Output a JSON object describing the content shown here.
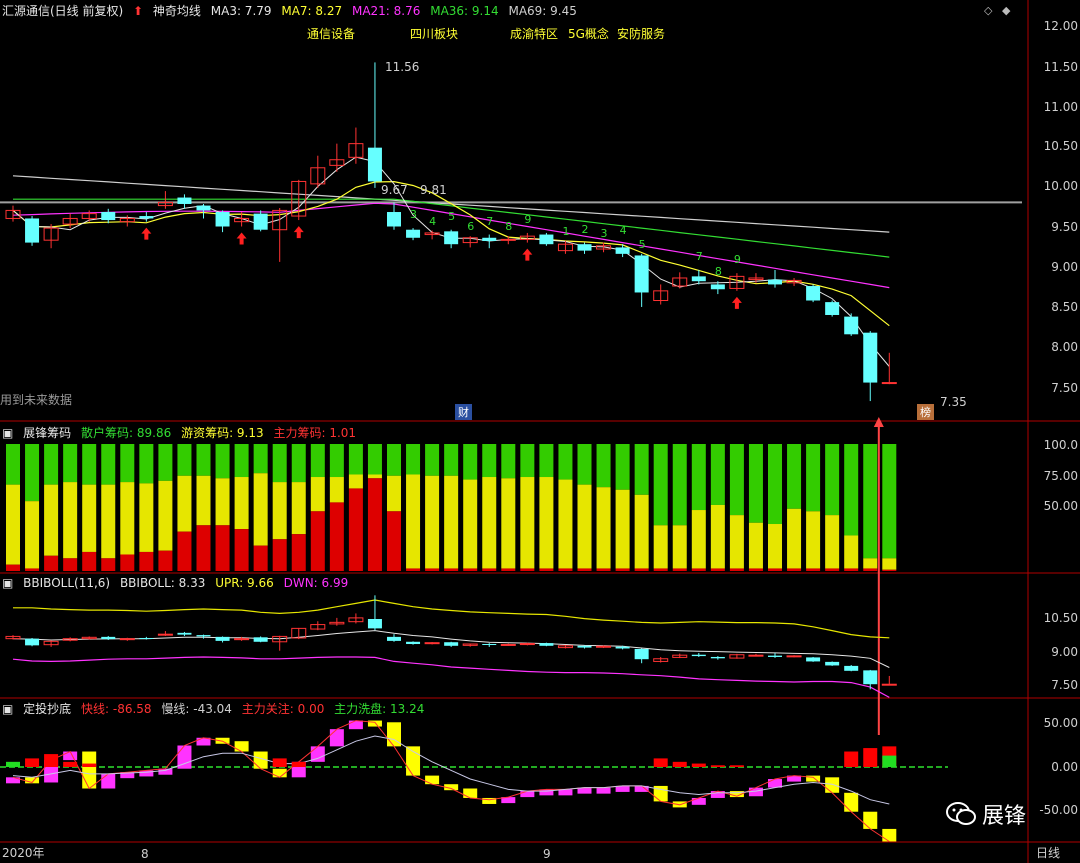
{
  "main_header": {
    "stock_title": "汇源通信(日线 前复权)",
    "indicator_name": "神奇均线",
    "ma3": "MA3: 7.79",
    "ma7": "MA7: 8.27",
    "ma21": "MA21: 8.76",
    "ma36": "MA36: 9.14",
    "ma69": "MA69: 9.45"
  },
  "concept_tags": [
    "通信设备",
    "四川板块",
    "成渝特区",
    "5G概念",
    "安防服务"
  ],
  "price_axis_labels": [
    "12.00",
    "11.50",
    "11.00",
    "10.50",
    "10.00",
    "9.50",
    "9.00",
    "8.50",
    "8.00",
    "7.50"
  ],
  "annotations": {
    "high_label": "11.56",
    "low_label": "7.35",
    "ref_label_1": "9.67",
    "ref_label_2": "9.81",
    "future_data_note": "用到未来数据",
    "finance_marker": "财",
    "rank_marker": "榜",
    "count_marks": [
      "3",
      "4",
      "5",
      "6",
      "7",
      "8",
      "9",
      "1",
      "2",
      "3",
      "4",
      "5",
      "7",
      "8",
      "9"
    ]
  },
  "panel2": {
    "name": "展锋筹码",
    "retail_label": "散户筹码: 89.86",
    "hot_money_label": "游资筹码: 9.13",
    "main_force_label": "主力筹码: 1.01",
    "axis": [
      "100.0",
      "75.00",
      "50.00"
    ]
  },
  "panel3": {
    "name": "BBIBOLL(11,6)",
    "bbiboll_label": "BBIBOLL: 8.33",
    "upr_label": "UPR: 9.66",
    "dwn_label": "DWN: 6.99",
    "axis": [
      "10.50",
      "9.00",
      "7.50"
    ]
  },
  "panel4": {
    "name": "定投抄底",
    "fast_label": "快线: -86.58",
    "slow_label": "慢线: -43.04",
    "focus_label": "主力关注: 0.00",
    "wash_label": "主力洗盘: 13.24",
    "axis": [
      "50.00",
      "0.00",
      "-50.00"
    ]
  },
  "bottom_bar": {
    "year": "2020年",
    "month_8": "8",
    "month_9": "9",
    "period": "日线"
  },
  "watermark": {
    "text": "展锋"
  },
  "colors": {
    "background": "#000000",
    "up_candle": "#ff3333",
    "down_candle": "#66ffff",
    "ma3": "#e6e6e6",
    "ma7": "#ffff33",
    "ma21": "#ff33ff",
    "ma36": "#33dd33",
    "ma69": "#cfcfcf",
    "retail": "#33cc00",
    "hot_money": "#e6e600",
    "main_force": "#dd0000"
  },
  "chart_data": {
    "type": "candlestick",
    "period": "daily",
    "candles": [
      {
        "o": 9.62,
        "c": 9.72,
        "h": 9.78,
        "l": 9.58
      },
      {
        "o": 9.62,
        "c": 9.32,
        "h": 9.65,
        "l": 9.28
      },
      {
        "o": 9.35,
        "c": 9.5,
        "h": 9.55,
        "l": 9.25
      },
      {
        "o": 9.55,
        "c": 9.62,
        "h": 9.68,
        "l": 9.5
      },
      {
        "o": 9.62,
        "c": 9.68,
        "h": 9.72,
        "l": 9.58
      },
      {
        "o": 9.7,
        "c": 9.6,
        "h": 9.74,
        "l": 9.56
      },
      {
        "o": 9.58,
        "c": 9.62,
        "h": 9.66,
        "l": 9.52
      },
      {
        "o": 9.65,
        "c": 9.62,
        "h": 9.7,
        "l": 9.58
      },
      {
        "o": 9.78,
        "c": 9.82,
        "h": 9.96,
        "l": 9.74
      },
      {
        "o": 9.88,
        "c": 9.8,
        "h": 9.92,
        "l": 9.74
      },
      {
        "o": 9.78,
        "c": 9.72,
        "h": 9.8,
        "l": 9.62
      },
      {
        "o": 9.7,
        "c": 9.52,
        "h": 9.72,
        "l": 9.45
      },
      {
        "o": 9.58,
        "c": 9.62,
        "h": 9.7,
        "l": 9.52
      },
      {
        "o": 9.68,
        "c": 9.48,
        "h": 9.72,
        "l": 9.46
      },
      {
        "o": 9.48,
        "c": 9.72,
        "h": 9.75,
        "l": 9.08
      },
      {
        "o": 9.65,
        "c": 10.08,
        "h": 10.1,
        "l": 9.6
      },
      {
        "o": 10.05,
        "c": 10.25,
        "h": 10.4,
        "l": 10.0
      },
      {
        "o": 10.28,
        "c": 10.35,
        "h": 10.55,
        "l": 10.2
      },
      {
        "o": 10.38,
        "c": 10.55,
        "h": 10.75,
        "l": 10.3
      },
      {
        "o": 10.5,
        "c": 10.08,
        "h": 11.56,
        "l": 10.0
      },
      {
        "o": 9.7,
        "c": 9.52,
        "h": 9.82,
        "l": 9.48
      },
      {
        "o": 9.48,
        "c": 9.38,
        "h": 9.5,
        "l": 9.35
      },
      {
        "o": 9.42,
        "c": 9.44,
        "h": 9.47,
        "l": 9.36
      },
      {
        "o": 9.46,
        "c": 9.3,
        "h": 9.48,
        "l": 9.25
      },
      {
        "o": 9.32,
        "c": 9.38,
        "h": 9.4,
        "l": 9.26
      },
      {
        "o": 9.38,
        "c": 9.34,
        "h": 9.42,
        "l": 9.25
      },
      {
        "o": 9.35,
        "c": 9.36,
        "h": 9.4,
        "l": 9.3
      },
      {
        "o": 9.36,
        "c": 9.4,
        "h": 9.44,
        "l": 9.32
      },
      {
        "o": 9.42,
        "c": 9.3,
        "h": 9.44,
        "l": 9.28
      },
      {
        "o": 9.22,
        "c": 9.3,
        "h": 9.34,
        "l": 9.18
      },
      {
        "o": 9.3,
        "c": 9.22,
        "h": 9.32,
        "l": 9.18
      },
      {
        "o": 9.24,
        "c": 9.28,
        "h": 9.32,
        "l": 9.2
      },
      {
        "o": 9.26,
        "c": 9.18,
        "h": 9.3,
        "l": 9.14
      },
      {
        "o": 9.16,
        "c": 8.7,
        "h": 9.18,
        "l": 8.52
      },
      {
        "o": 8.6,
        "c": 8.72,
        "h": 8.8,
        "l": 8.55
      },
      {
        "o": 8.78,
        "c": 8.88,
        "h": 8.95,
        "l": 8.75
      },
      {
        "o": 8.9,
        "c": 8.84,
        "h": 8.98,
        "l": 8.8
      },
      {
        "o": 8.8,
        "c": 8.74,
        "h": 8.84,
        "l": 8.68
      },
      {
        "o": 8.75,
        "c": 8.9,
        "h": 8.94,
        "l": 8.72
      },
      {
        "o": 8.86,
        "c": 8.88,
        "h": 8.94,
        "l": 8.82
      },
      {
        "o": 8.86,
        "c": 8.8,
        "h": 8.98,
        "l": 8.76
      },
      {
        "o": 8.82,
        "c": 8.85,
        "h": 8.88,
        "l": 8.78
      },
      {
        "o": 8.78,
        "c": 8.6,
        "h": 8.8,
        "l": 8.58
      },
      {
        "o": 8.58,
        "c": 8.42,
        "h": 8.6,
        "l": 8.4
      },
      {
        "o": 8.4,
        "c": 8.18,
        "h": 8.44,
        "l": 8.16
      },
      {
        "o": 8.2,
        "c": 7.58,
        "h": 8.22,
        "l": 7.35
      },
      {
        "o": 7.58,
        "c": 7.58,
        "h": 7.95,
        "l": 7.56
      }
    ],
    "chip_distribution": {
      "series_order": [
        "main_force",
        "hot_money",
        "retail"
      ],
      "main_force": [
        5,
        2,
        12,
        10,
        15,
        10,
        13,
        15,
        16,
        31,
        36,
        36,
        33,
        20,
        25,
        29,
        47,
        54,
        65,
        73,
        47,
        2,
        2,
        2,
        2,
        2,
        2,
        2,
        2,
        2,
        2,
        2,
        2,
        2,
        2,
        2,
        2,
        2,
        2,
        2,
        2,
        2,
        2,
        2,
        2,
        2,
        1
      ],
      "hot_money": [
        63,
        53,
        56,
        60,
        53,
        58,
        57,
        54,
        55,
        44,
        39,
        37,
        41,
        57,
        45,
        41,
        27,
        20,
        11,
        3,
        28,
        74,
        73,
        73,
        70,
        72,
        71,
        72,
        72,
        70,
        66,
        64,
        62,
        58,
        34,
        34,
        46,
        50,
        42,
        36,
        35,
        47,
        45,
        42,
        26,
        8,
        9
      ]
    },
    "bbiboll": {
      "bbiboll": [
        9.62,
        9.6,
        9.56,
        9.58,
        9.6,
        9.61,
        9.62,
        9.62,
        9.65,
        9.68,
        9.68,
        9.66,
        9.66,
        9.63,
        9.62,
        9.68,
        9.76,
        9.85,
        9.92,
        9.98,
        9.86,
        9.76,
        9.7,
        9.6,
        9.52,
        9.46,
        9.44,
        9.42,
        9.4,
        9.36,
        9.32,
        9.3,
        9.28,
        9.2,
        9.12,
        9.08,
        9.06,
        9.04,
        9.02,
        9.0,
        8.98,
        8.96,
        8.94,
        8.9,
        8.84,
        8.74,
        8.33
      ],
      "upr": [
        11.0,
        11.0,
        10.95,
        10.92,
        10.9,
        10.9,
        10.88,
        10.85,
        10.88,
        10.92,
        10.95,
        10.92,
        10.9,
        10.8,
        10.75,
        10.8,
        10.9,
        11.05,
        11.2,
        11.35,
        11.2,
        11.05,
        10.95,
        10.88,
        10.82,
        10.78,
        10.75,
        10.72,
        10.7,
        10.62,
        10.52,
        10.45,
        10.4,
        10.35,
        10.32,
        10.35,
        10.38,
        10.36,
        10.34,
        10.34,
        10.32,
        10.28,
        10.15,
        9.98,
        9.8,
        9.7,
        9.66
      ],
      "dwn": [
        8.7,
        8.62,
        8.6,
        8.62,
        8.66,
        8.7,
        8.72,
        8.72,
        8.75,
        8.78,
        8.8,
        8.78,
        8.76,
        8.72,
        8.72,
        8.75,
        8.78,
        8.8,
        8.8,
        8.78,
        8.6,
        8.52,
        8.45,
        8.35,
        8.3,
        8.25,
        8.2,
        8.15,
        8.12,
        8.1,
        8.1,
        8.08,
        8.05,
        8.0,
        7.96,
        7.9,
        7.82,
        7.78,
        7.75,
        7.72,
        7.7,
        7.68,
        7.7,
        7.7,
        7.65,
        7.45,
        6.99
      ]
    },
    "timing_oscillator": {
      "fast": [
        -12,
        -18,
        8,
        18,
        -25,
        -8,
        -6,
        -4,
        -2,
        25,
        34,
        30,
        18,
        -2,
        -12,
        6,
        24,
        44,
        54,
        52,
        24,
        -10,
        -20,
        -25,
        -36,
        -38,
        -35,
        -28,
        -26,
        -26,
        -24,
        -24,
        -22,
        -22,
        -40,
        -44,
        -36,
        -28,
        -34,
        -24,
        -14,
        -10,
        -12,
        -30,
        -52,
        -72,
        -86.58
      ],
      "slow": [
        -10,
        -12,
        -8,
        -4,
        -8,
        -8,
        -7,
        -6,
        -4,
        4,
        12,
        16,
        16,
        10,
        4,
        4,
        10,
        20,
        30,
        36,
        32,
        18,
        6,
        -4,
        -14,
        -20,
        -26,
        -28,
        -28,
        -26,
        -24,
        -24,
        -22,
        -22,
        -26,
        -30,
        -32,
        -30,
        -30,
        -28,
        -24,
        -20,
        -18,
        -20,
        -28,
        -38,
        -43.04
      ],
      "main_force_focus": [
        0,
        10,
        15,
        6,
        4,
        0,
        0,
        0,
        0,
        0,
        0,
        0,
        0,
        0,
        10,
        6,
        0,
        0,
        0,
        0,
        0,
        0,
        0,
        0,
        0,
        0,
        0,
        0,
        0,
        0,
        0,
        0,
        0,
        0,
        10,
        6,
        4,
        2,
        2,
        0,
        0,
        0,
        0,
        0,
        18,
        22,
        24
      ],
      "wash": [
        6,
        0,
        0,
        0,
        0,
        0,
        0,
        0,
        0,
        0,
        0,
        0,
        0,
        0,
        0,
        0,
        0,
        0,
        0,
        0,
        0,
        0,
        0,
        0,
        0,
        0,
        0,
        0,
        0,
        0,
        0,
        0,
        0,
        0,
        0,
        0,
        0,
        0,
        0,
        0,
        0,
        0,
        0,
        0,
        0,
        0,
        13.24
      ]
    }
  }
}
